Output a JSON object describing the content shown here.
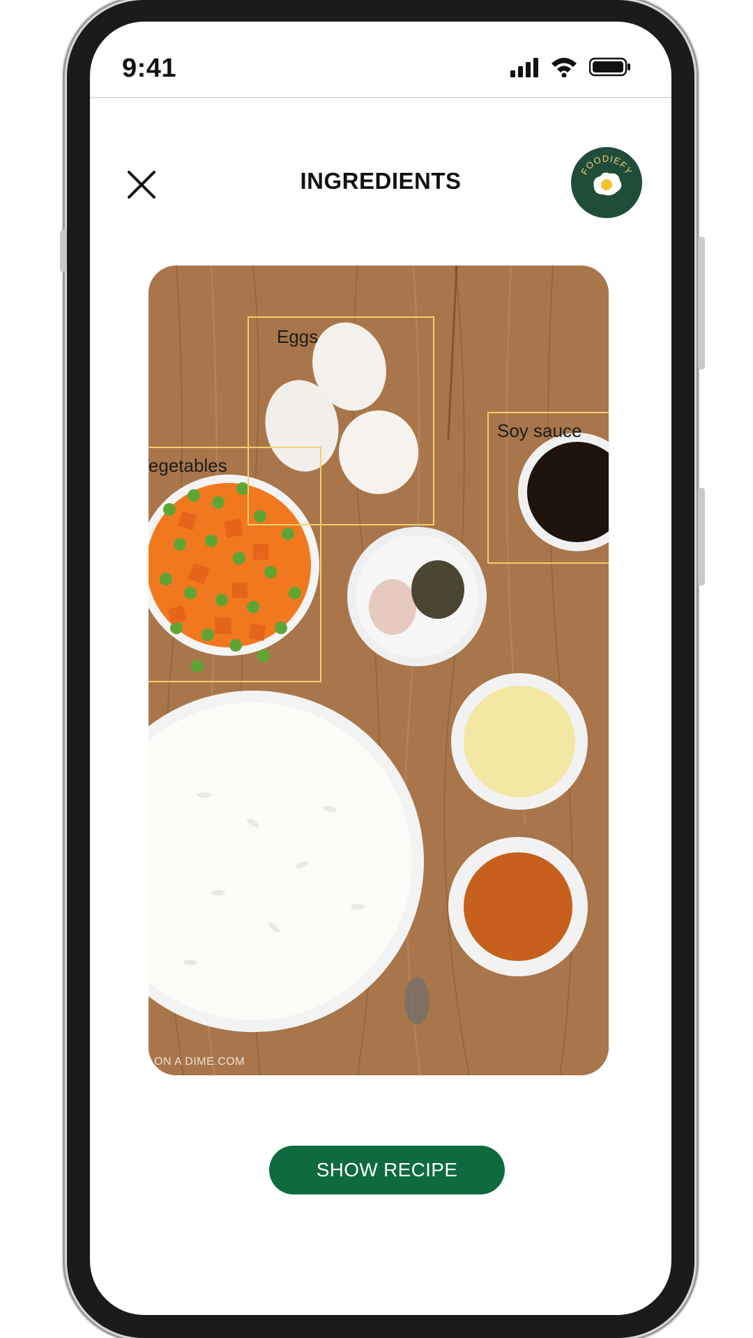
{
  "status_bar": {
    "time": "9:41"
  },
  "header": {
    "title": "INGREDIENTS",
    "logo_text": "FOODIEFY"
  },
  "detections": [
    {
      "label": "Eggs"
    },
    {
      "label": "Soy sauce"
    },
    {
      "label": "Vegetables"
    }
  ],
  "photo": {
    "watermark": "ON A DIME.COM"
  },
  "actions": {
    "show_recipe_label": "SHOW RECIPE"
  },
  "colors": {
    "brand_green": "#0f6a3d",
    "logo_green": "#1f4d3a",
    "detection_box": "#f2cf6d"
  },
  "icons": [
    "close-icon",
    "signal-icon",
    "wifi-icon",
    "battery-icon",
    "egg-logo-icon"
  ]
}
